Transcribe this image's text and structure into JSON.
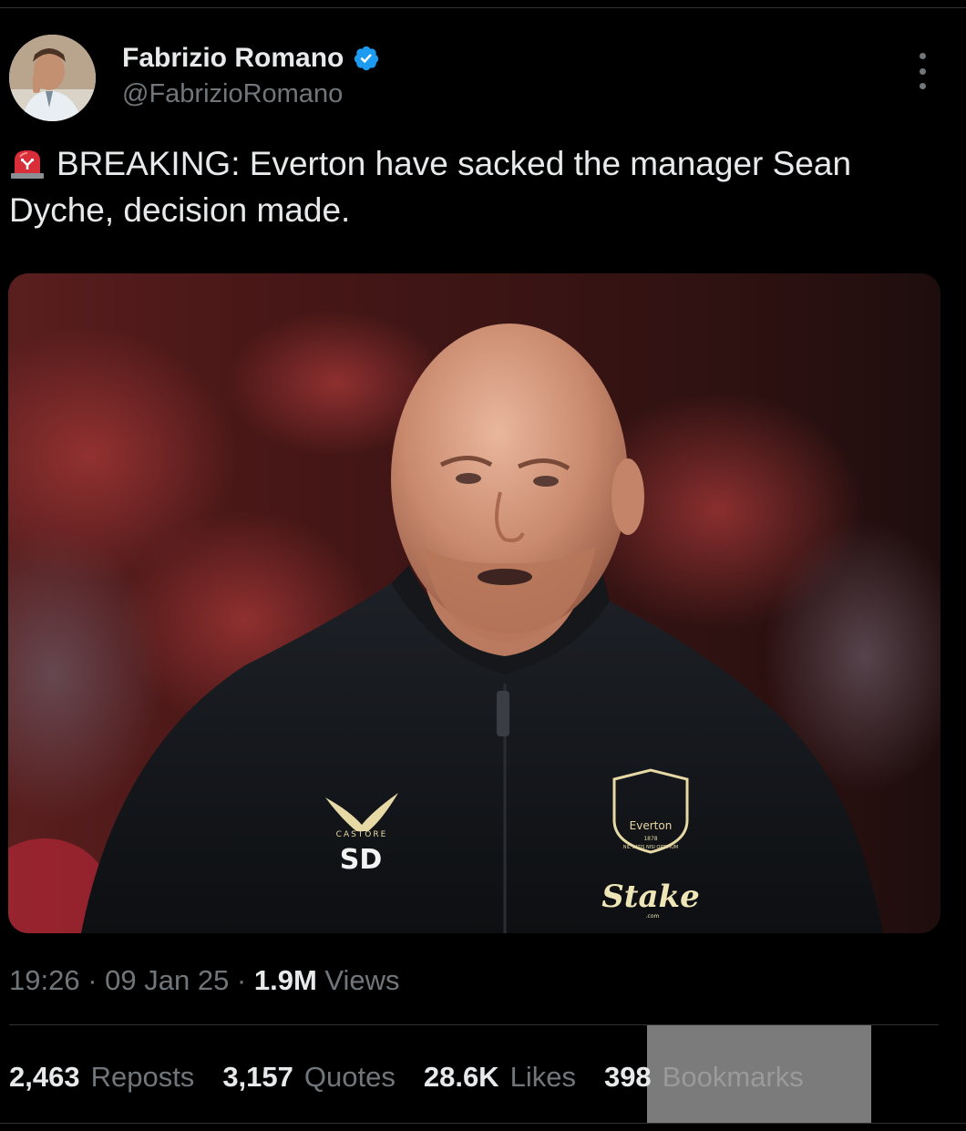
{
  "author": {
    "display_name": "Fabrizio Romano",
    "handle": "@FabrizioRomano",
    "verified": true,
    "verified_color": "#1d9bf0"
  },
  "tweet": {
    "icon": "siren-icon",
    "text": "BREAKING: Everton have sacked the manager Sean Dyche, decision made."
  },
  "media": {
    "jacket_brand_text": "CASTORE",
    "jacket_initials": "SD",
    "crest_text": "Everton",
    "crest_year": "1878",
    "crest_motto": "NIL SATIS NISI OPTIMUM",
    "sponsor_text": "Stake",
    "sponsor_sub": ".com"
  },
  "meta": {
    "time": "19:26",
    "separator1": " · ",
    "date": "09 Jan 25",
    "separator2": " · ",
    "views_count": "1.9M",
    "views_label": "Views"
  },
  "stats": {
    "reposts": {
      "count": "2,463",
      "label": "Reposts"
    },
    "quotes": {
      "count": "3,157",
      "label": "Quotes"
    },
    "likes": {
      "count": "28.6K",
      "label": "Likes"
    },
    "bookmarks": {
      "count": "398",
      "label": "Bookmarks"
    }
  },
  "colors": {
    "background": "#000000",
    "text_primary": "#e7e9ea",
    "text_secondary": "#71767b",
    "divider": "#2f3336",
    "bookmarks_highlight": "#7b7b7b"
  }
}
